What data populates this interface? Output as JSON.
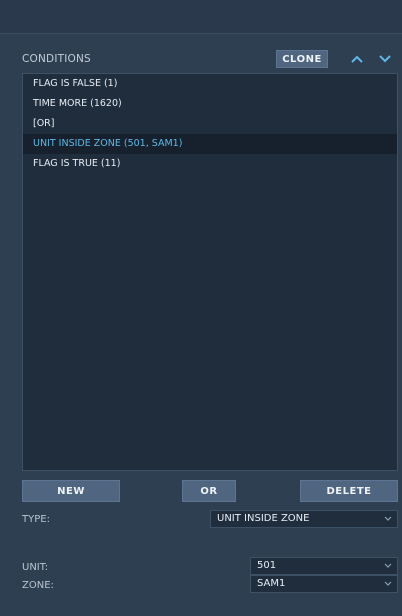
{
  "conditions": {
    "title": "CONDITIONS",
    "clone_label": "CLONE",
    "items": [
      {
        "label": "FLAG IS FALSE (1)",
        "selected": false
      },
      {
        "label": "TIME MORE (1620)",
        "selected": false
      },
      {
        "label": "[OR]",
        "selected": false
      },
      {
        "label": "UNIT INSIDE ZONE (501, SAM1)",
        "selected": true
      },
      {
        "label": "FLAG IS TRUE (11)",
        "selected": false
      }
    ]
  },
  "actions": {
    "new_label": "NEW",
    "or_label": "OR",
    "delete_label": "DELETE"
  },
  "fields": {
    "type_label": "TYPE:",
    "type_value": "UNIT INSIDE ZONE",
    "unit_label": "UNIT:",
    "unit_value": "501",
    "zone_label": "ZONE:",
    "zone_value": "SAM1"
  },
  "icons": {
    "up": "chevron-up-icon",
    "down": "chevron-down-icon",
    "caret": "chevron-down-icon"
  },
  "colors": {
    "panel_bg": "#2e3f52",
    "list_bg": "#1f2d3d",
    "button_bg": "#4f6580",
    "selected_text": "#5fb8e8",
    "accent_arrow": "#5fb8e8"
  }
}
